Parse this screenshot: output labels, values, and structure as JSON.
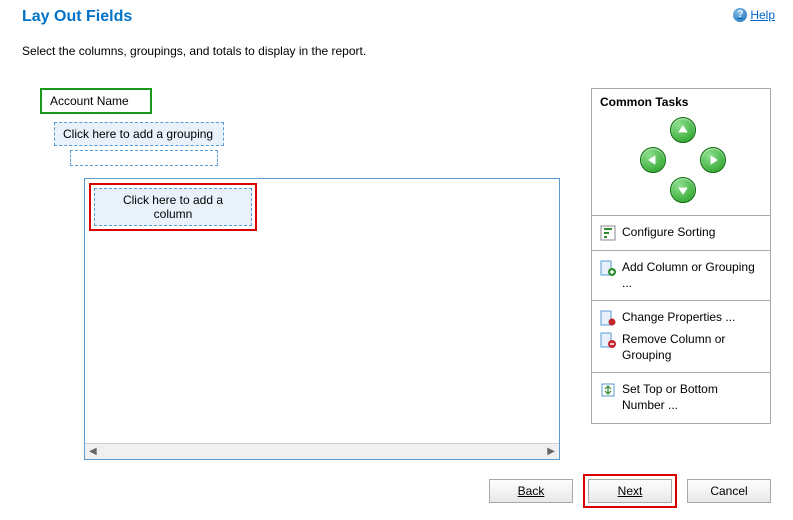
{
  "header": {
    "title": "Lay Out Fields",
    "help_label": "Help"
  },
  "instruction": "Select the columns, groupings, and totals to display in the report.",
  "layout": {
    "primary_field": "Account Name",
    "grouping_placeholder": "Click here to add a grouping",
    "column_placeholder": "Click here to add a column"
  },
  "tasks": {
    "panel_title": "Common Tasks",
    "items": {
      "configure_sorting": "Configure Sorting",
      "add_column": "Add Column or Grouping ...",
      "change_properties": "Change Properties ...",
      "remove_column": "Remove Column or Grouping",
      "set_top_bottom": "Set Top or Bottom Number ..."
    }
  },
  "buttons": {
    "back": "Back",
    "next": "Next",
    "cancel": "Cancel"
  }
}
